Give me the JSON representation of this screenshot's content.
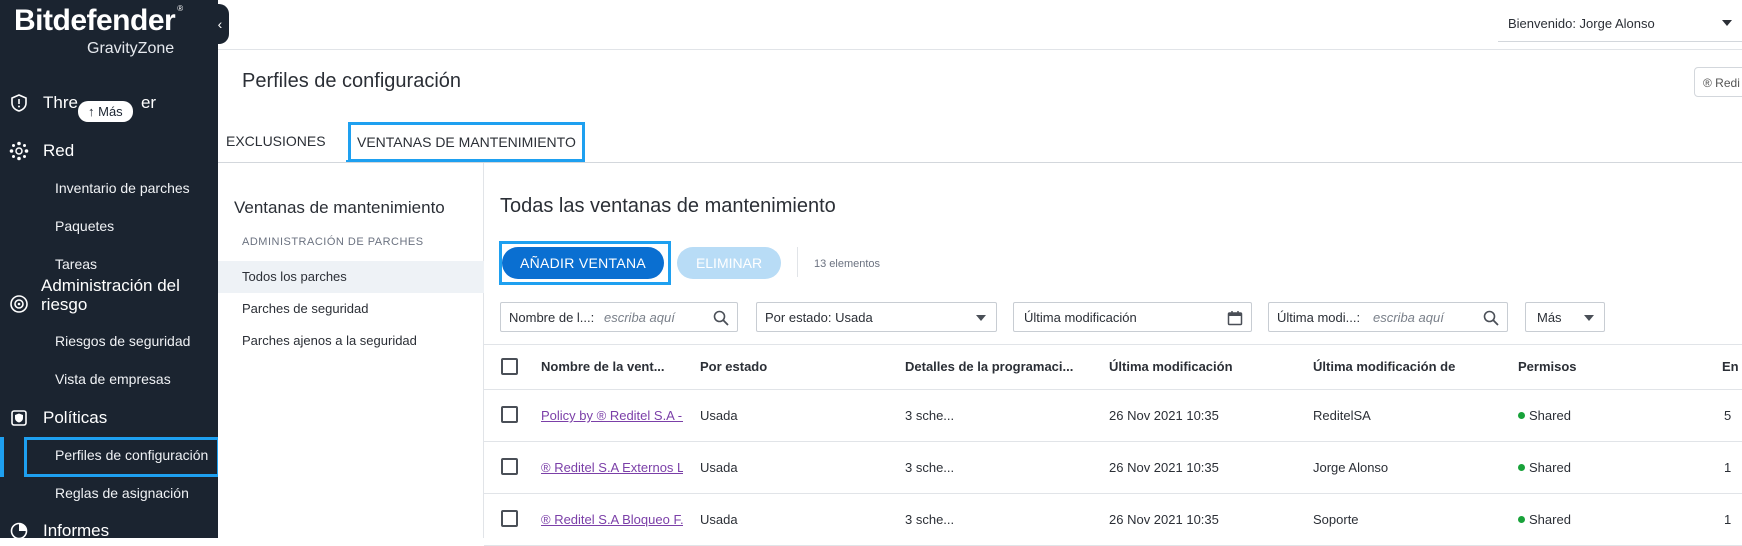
{
  "sidebar": {
    "brand": "Bitdefender",
    "brand_reg": "®",
    "product": "GravityZone",
    "collapse_glyph": "‹",
    "tooltip": "↑ Más",
    "sections": [
      {
        "label": "Threat Hunter",
        "icon": "shield-icon"
      },
      {
        "label": "Red",
        "icon": "network-icon"
      },
      {
        "label": "Administración del riesgo",
        "icon": "risk-icon"
      },
      {
        "label": "Políticas",
        "icon": "policy-icon"
      },
      {
        "label": "Informes",
        "icon": "reports-icon"
      }
    ],
    "threat_label_a": "Thre",
    "threat_label_b": "er",
    "items": {
      "inventario": "Inventario de parches",
      "paquetes": "Paquetes",
      "tareas": "Tareas",
      "riesgos": "Riesgos de seguridad",
      "empresas": "Vista de empresas",
      "perfiles": "Perfiles de configuración",
      "reglas": "Reglas de asignación"
    },
    "riesgo_line1": "Administración del",
    "riesgo_line2": "riesgo"
  },
  "header": {
    "welcome": "Bienvenido: Jorge Alonso",
    "company_pill": "® Redi"
  },
  "page": {
    "title": "Perfiles de configuración",
    "tabs": [
      "EXCLUSIONES",
      "VENTANAS DE MANTENIMIENTO"
    ]
  },
  "subnav": {
    "title": "Ventanas de mantenimiento",
    "category": "ADMINISTRACIÓN DE PARCHES",
    "items": [
      "Todos los parches",
      "Parches de seguridad",
      "Parches ajenos a la seguridad"
    ]
  },
  "main": {
    "title": "Todas las ventanas de mantenimiento",
    "add_button": "AÑADIR VENTANA",
    "delete_button": "ELIMINAR",
    "count": "13 elementos",
    "filters": {
      "name_label": "Nombre de l...:",
      "name_placeholder": "escriba aquí",
      "state_label": "Por estado: Usada",
      "modified_label": "Última modificación",
      "modified_by_label": "Última modi...:",
      "modified_by_placeholder": "escriba aquí",
      "more_label": "Más"
    }
  },
  "table": {
    "columns": [
      "Nombre de la vent...",
      "Por estado",
      "Detalles de la programaci...",
      "Última modificación",
      "Última modificación de",
      "Permisos",
      "En"
    ],
    "rows": [
      {
        "name": "Policy by ® Reditel S.A - ...",
        "state": "Usada",
        "details": "3 sche...",
        "modified": "26 Nov 2021 10:35",
        "modified_by": "ReditelSA",
        "permissions": "Shared",
        "count": "5"
      },
      {
        "name": "® Reditel S.A Externos L...",
        "state": "Usada",
        "details": "3 sche...",
        "modified": "26 Nov 2021 10:35",
        "modified_by": "Jorge Alonso",
        "permissions": "Shared",
        "count": "1"
      },
      {
        "name": "® Reditel S.A Bloqueo F...",
        "state": "Usada",
        "details": "3 sche...",
        "modified": "26 Nov 2021 10:35",
        "modified_by": "Soporte",
        "permissions": "Shared",
        "count": "1"
      }
    ]
  },
  "colors": {
    "sidebar_bg": "#1b2430",
    "accent_highlight": "#1ea0f0",
    "primary_button": "#0a6fd1",
    "disabled_button": "#b8dcf6",
    "link": "#7b3fa8",
    "shared_dot": "#18a23a"
  }
}
